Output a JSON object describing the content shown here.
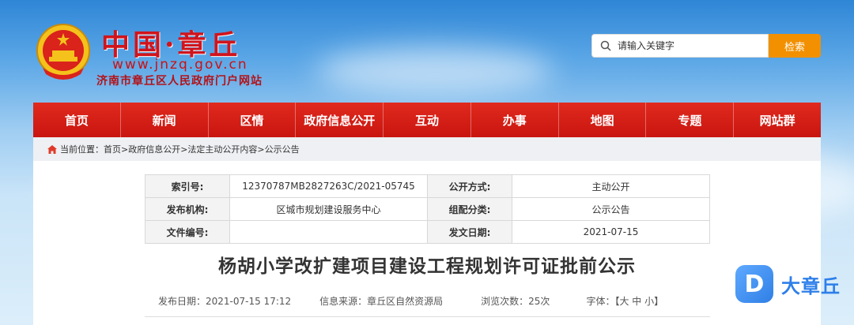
{
  "header": {
    "logo_title": "中国·章丘",
    "logo_url": "www.jnzq.gov.cn",
    "logo_subtitle": "济南市章丘区人民政府门户网站"
  },
  "search": {
    "placeholder": "请输入关键字",
    "button_label": "检索"
  },
  "nav": {
    "items": [
      {
        "label": "首页"
      },
      {
        "label": "新闻"
      },
      {
        "label": "区情"
      },
      {
        "label": "政府信息公开"
      },
      {
        "label": "互动"
      },
      {
        "label": "办事"
      },
      {
        "label": "地图"
      },
      {
        "label": "专题"
      },
      {
        "label": "网站群"
      }
    ]
  },
  "breadcrumb": {
    "text": "当前位置：首页>政府信息公开>法定主动公开内容>公示公告"
  },
  "meta": {
    "index_label": "索引号:",
    "index_value": "12370787MB2827263C/2021-05745",
    "open_mode_label": "公开方式:",
    "open_mode_value": "主动公开",
    "publisher_label": "发布机构:",
    "publisher_value": "区城市规划建设服务中心",
    "category_label": "组配分类:",
    "category_value": "公示公告",
    "doc_no_label": "文件编号:",
    "doc_no_value": "",
    "date_label": "发文日期:",
    "date_value": "2021-07-15"
  },
  "article": {
    "title": "杨胡小学改扩建项目建设工程规划许可证批前公示",
    "publish_date": "发布日期：2021-07-15 17:12",
    "source": "信息来源：章丘区自然资源局",
    "views": "浏览次数：25次",
    "font_size": "字体：【大 中 小】"
  },
  "watermark": {
    "icon_letter": "D",
    "text": "大章丘"
  }
}
